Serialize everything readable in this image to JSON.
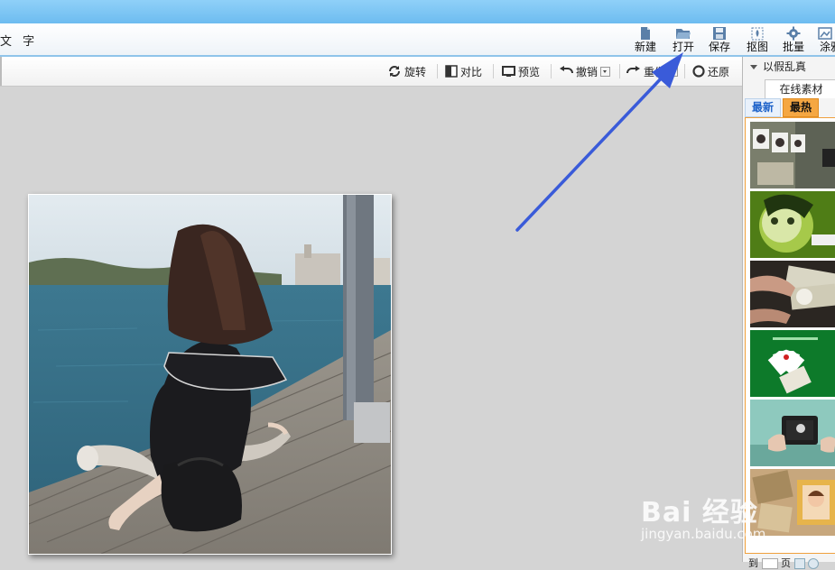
{
  "toolbar": {
    "tab_label": "文 字",
    "items": [
      {
        "label": "新建",
        "icon": "new-file-icon"
      },
      {
        "label": "打开",
        "icon": "open-folder-icon"
      },
      {
        "label": "保存",
        "icon": "save-disk-icon"
      },
      {
        "label": "抠图",
        "icon": "cutout-icon"
      },
      {
        "label": "批量",
        "icon": "batch-gear-icon"
      },
      {
        "label": "涂鸦",
        "icon": "doodle-icon"
      }
    ]
  },
  "subbar": {
    "rotate": "旋转",
    "compare": "对比",
    "preview": "预览",
    "undo": "撤销",
    "redo": "重做",
    "restore": "还原"
  },
  "panel": {
    "header": "以假乱真",
    "online_tab": "在线素材",
    "tab_newest": "最新",
    "tab_hottest": "最热",
    "footer_left": "到",
    "footer_mid": "页"
  },
  "watermark": {
    "brand": "Bai 经验",
    "url": "jingyan.baidu.com"
  },
  "colors": {
    "accent_blue": "#3a5bd9",
    "tab_orange": "#f0a03c",
    "title_blue": "#79c3f2"
  }
}
